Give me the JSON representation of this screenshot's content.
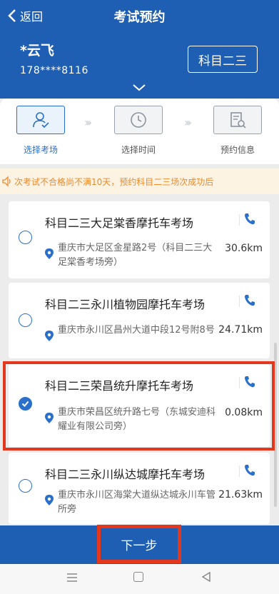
{
  "header": {
    "back_label": "返回",
    "title": "考试预约",
    "user_name": "*云飞",
    "user_phone": "178****8116",
    "subject_button": "科目二三",
    "accent_color": "#1e5fb3"
  },
  "steps": [
    {
      "label": "选择考场",
      "icon": "person-check-icon",
      "active": true
    },
    {
      "label": "选择时间",
      "icon": "clock-icon",
      "active": false
    },
    {
      "label": "预约信息",
      "icon": "document-search-icon",
      "active": false
    }
  ],
  "notice": {
    "icon": "speaker-icon",
    "text": "次考试不合格尚不满10天，预约科目二三场次成功后"
  },
  "venues": [
    {
      "name": "科目二三大足棠香摩托车考场",
      "address": "重庆市大足区金星路2号（科目二三大足棠香考场旁）",
      "distance": "30.6km",
      "selected": false
    },
    {
      "name": "科目二三永川植物园摩托车考场",
      "address": "重庆市永川区昌州大道中段12号附8号",
      "distance": "24.71km",
      "selected": false
    },
    {
      "name": "科目二三荣昌统升摩托车考场",
      "address": "重庆市荣昌区统升路七号（东城安迪科耀业有限公司旁）",
      "distance": "0.08km",
      "selected": true
    },
    {
      "name": "科目二三永川纵达城摩托车考场",
      "address": "重庆市永川区海棠大道纵达城永川车管所旁",
      "distance": "21.63km",
      "selected": false
    }
  ],
  "footer": {
    "next_button": "下一步"
  },
  "colors": {
    "highlight": "#e3371e",
    "link_blue": "#2a6fc9",
    "notice_text": "#ec8a2c"
  }
}
